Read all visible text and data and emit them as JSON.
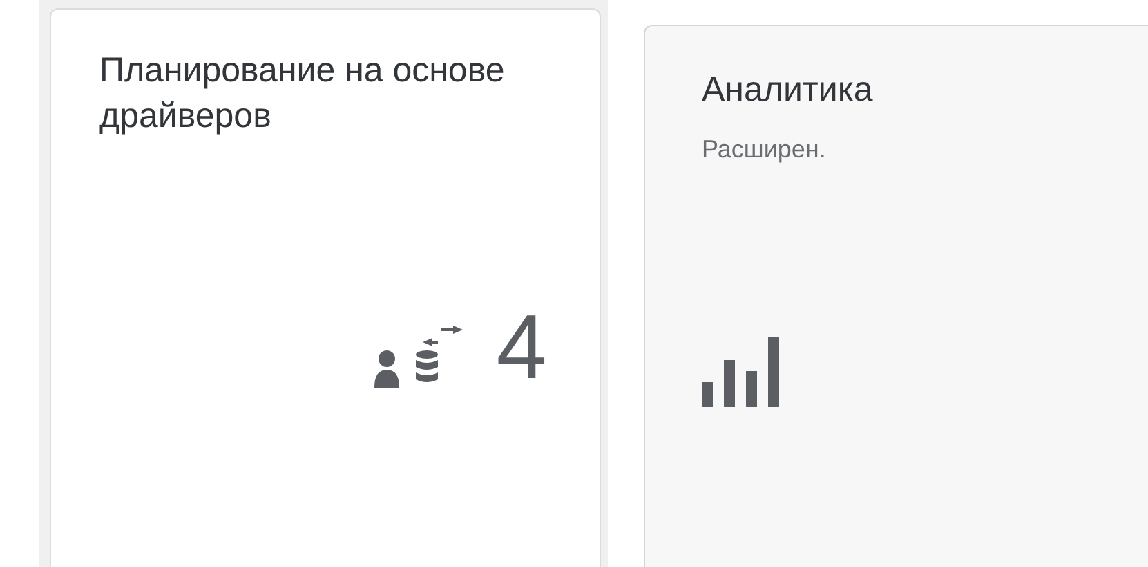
{
  "tiles": [
    {
      "kind": "counter",
      "title": "Планирование на основе драйверов",
      "number": "4",
      "hovered": false
    },
    {
      "kind": "chart",
      "title": "Аналитика",
      "subtitle": "Расширен.",
      "hovered": true
    }
  ]
}
